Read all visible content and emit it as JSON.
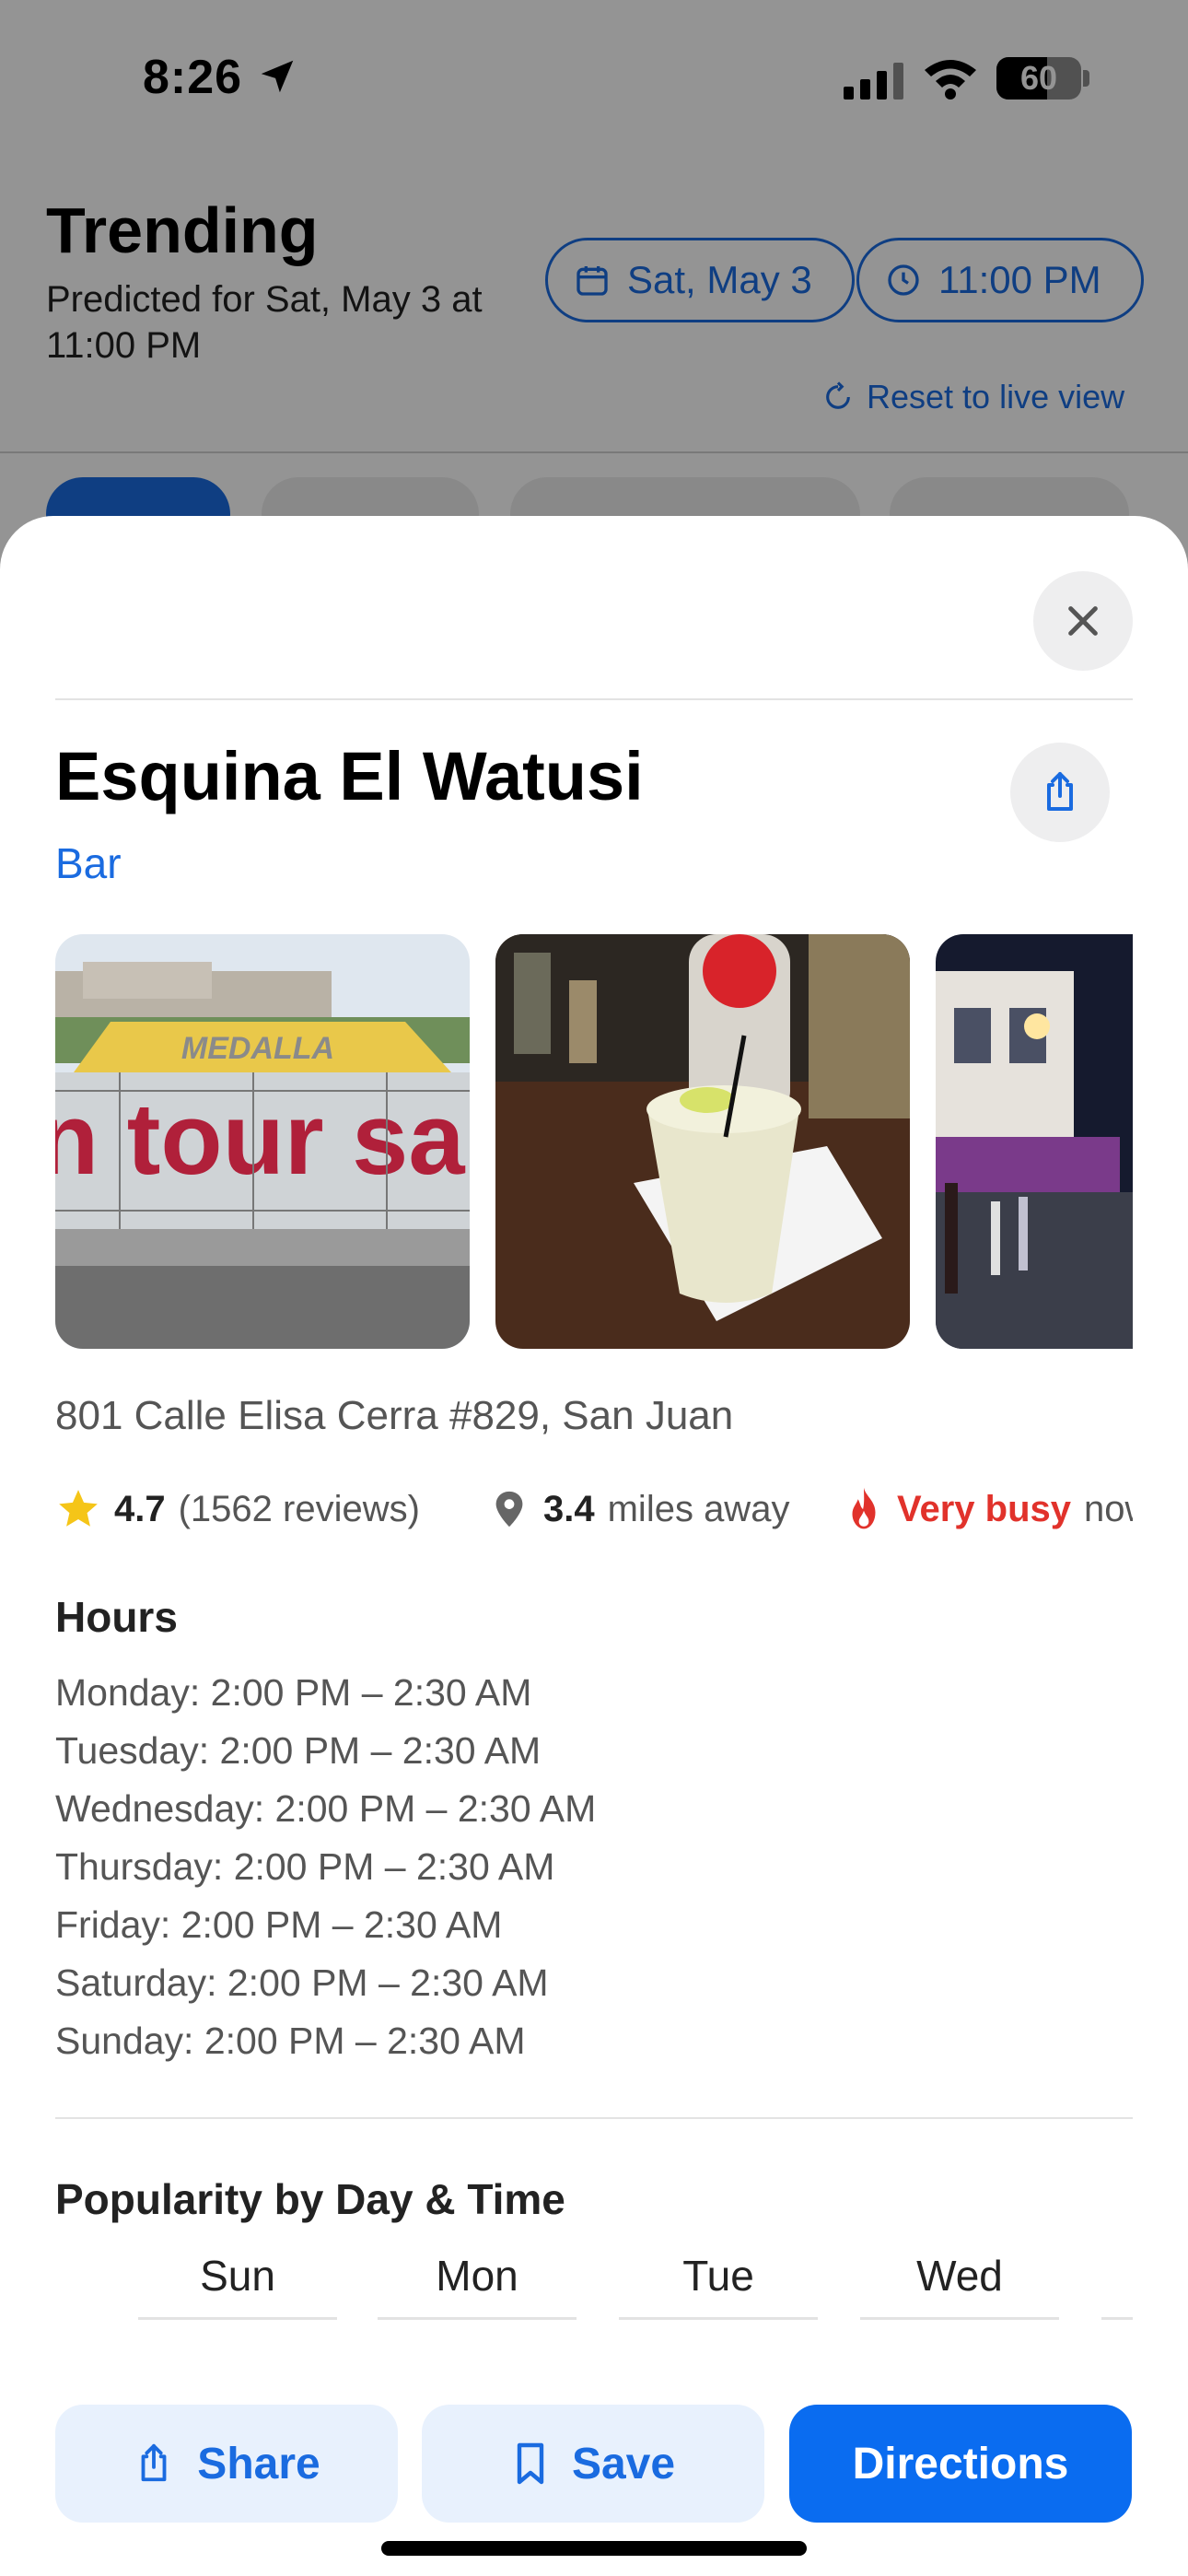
{
  "status_bar": {
    "time": "8:26",
    "battery": "60",
    "battery_level_percent": 60
  },
  "background": {
    "title": "Trending",
    "subtitle": "Predicted for Sat, May 3 at 11:00 PM",
    "date_pill": "Sat, May 3",
    "time_pill": "11:00 PM",
    "reset_label": "Reset to live view"
  },
  "place": {
    "name": "Esquina El Watusi",
    "category": "Bar",
    "address": "801 Calle Elisa Cerra #829, San Juan",
    "rating": "4.7",
    "reviews": "(1562 reviews)",
    "distance": "3.4",
    "distance_unit": "miles away",
    "busy_label": "Very busy",
    "busy_suffix": "now"
  },
  "hours": {
    "title": "Hours",
    "days": [
      "Monday: 2:00 PM – 2:30 AM",
      "Tuesday: 2:00 PM – 2:30 AM",
      "Wednesday: 2:00 PM – 2:30 AM",
      "Thursday: 2:00 PM – 2:30 AM",
      "Friday: 2:00 PM – 2:30 AM",
      "Saturday: 2:00 PM – 2:30 AM",
      "Sunday: 2:00 PM – 2:30 AM"
    ]
  },
  "popularity": {
    "title": "Popularity by Day & Time",
    "day_tabs": [
      "Sun",
      "Mon",
      "Tue",
      "Wed"
    ]
  },
  "actions": {
    "share": "Share",
    "save": "Save",
    "directions": "Directions"
  },
  "colors": {
    "accent": "#1a6be0",
    "directions_button": "#0a6cf0",
    "busy_red": "#e1322b",
    "star_yellow": "#f5c518"
  },
  "icons": [
    "location-arrow-icon",
    "signal-icon",
    "wifi-icon",
    "battery-icon",
    "calendar-icon",
    "clock-icon",
    "reset-icon",
    "close-icon",
    "share-icon",
    "star-icon",
    "map-pin-icon",
    "flame-icon",
    "bookmark-icon"
  ]
}
